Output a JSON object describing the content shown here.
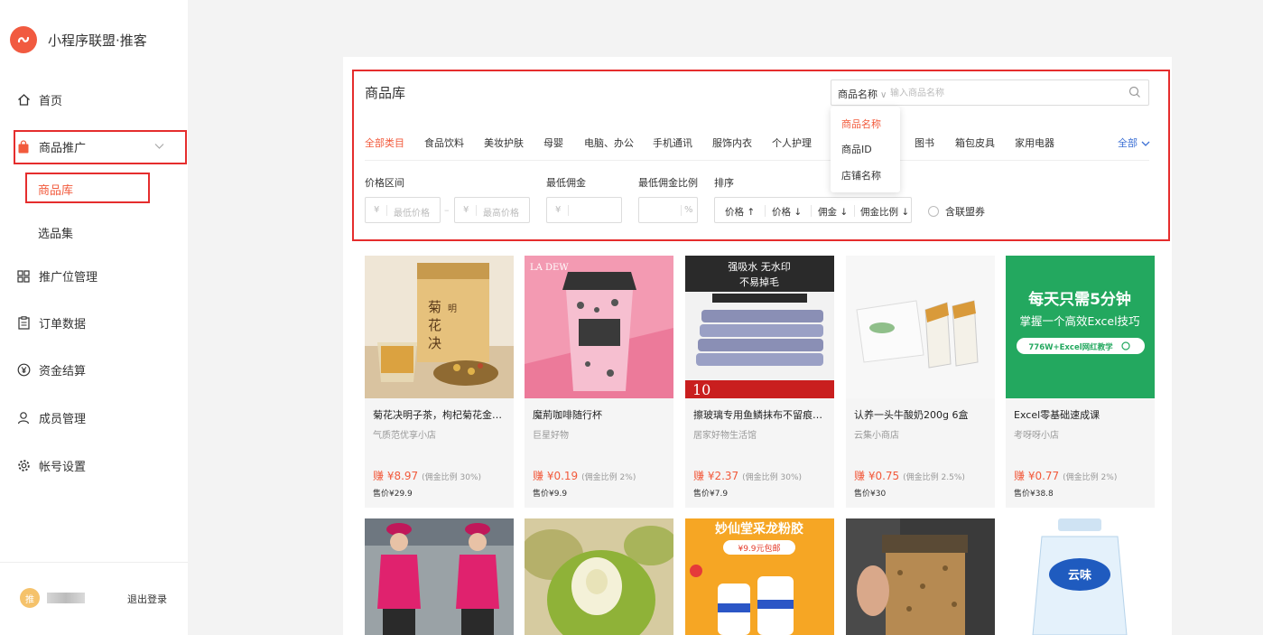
{
  "colors": {
    "accent": "#f25a3c",
    "highlight_border": "#e52d2d",
    "link_blue": "#3b6fd4"
  },
  "brand": {
    "title": "小程序联盟·推客"
  },
  "nav": {
    "home": "首页",
    "promotion": "商品推广",
    "library": "商品库",
    "selection": "选品集",
    "slots": "推广位管理",
    "orders": "订单数据",
    "settlement": "资金结算",
    "members": "成员管理",
    "account": "帐号设置"
  },
  "footer": {
    "avatar_text": "推",
    "logout": "退出登录"
  },
  "page": {
    "title": "商品库"
  },
  "search": {
    "type_label": "商品名称",
    "placeholder": "输入商品名称"
  },
  "dropdown": {
    "options": [
      "商品名称",
      "商品ID",
      "店铺名称"
    ],
    "selected": "商品名称"
  },
  "categories": [
    "全部类目",
    "食品饮料",
    "美妆护肤",
    "母婴",
    "电脑、办公",
    "手机通讯",
    "服饰内衣",
    "个人护理",
    "图书",
    "箱包皮具",
    "家用电器"
  ],
  "categories_all": "全部",
  "filters": {
    "price_range": "价格区间",
    "min_price_ph": "最低价格",
    "max_price_ph": "最高价格",
    "currency": "¥",
    "dash": "–",
    "min_commission": "最低佣金",
    "min_rate": "最低佣金比例",
    "percent": "%",
    "sort": "排序",
    "sort_options": [
      "价格 ↑",
      "价格 ↓",
      "佣金 ↓",
      "佣金比例 ↓"
    ],
    "coupon": "含联盟券"
  },
  "products": [
    {
      "name": "菊花决明子茶，枸杞菊花金银...",
      "shop": "气质范优享小店",
      "earn": "赚 ¥8.97",
      "rate": "(佣金比例 30%)",
      "price": "售价¥29.9",
      "image_text": "菊花决明茶"
    },
    {
      "name": "魔荊咖啡随行杯",
      "shop": "巨星好物",
      "earn": "赚 ¥0.19",
      "rate": "(佣金比例 2%)",
      "price": "售价¥9.9",
      "image_text": "LA DEW"
    },
    {
      "name": "擦玻璃专用鱼鳞抹布不留痕家...",
      "shop": "居家好物生活馆",
      "earn": "赚 ¥2.37",
      "rate": "(佣金比例 30%)",
      "price": "售价¥7.9",
      "image_text": "强吸水 无水印 不易掉毛"
    },
    {
      "name": "认养一头牛酸奶200g 6盒",
      "shop": "云集小商店",
      "earn": "赚 ¥0.75",
      "rate": "(佣金比例 2.5%)",
      "price": "售价¥30",
      "image_text": ""
    },
    {
      "name": "Excel零基础速成课",
      "shop": "考呀呀小店",
      "earn": "赚 ¥0.77",
      "rate": "(佣金比例 2%)",
      "price": "售价¥38.8",
      "image_text": "每天只需5分钟 掌握一个高效Excel技巧"
    }
  ],
  "banner_texts": {
    "excel_sub": "776W+Excel网红教学",
    "melon_badge": "¥9.9元包邮",
    "melon_title": "妙仙堂采龙粉胶",
    "water_brand": "云味"
  }
}
